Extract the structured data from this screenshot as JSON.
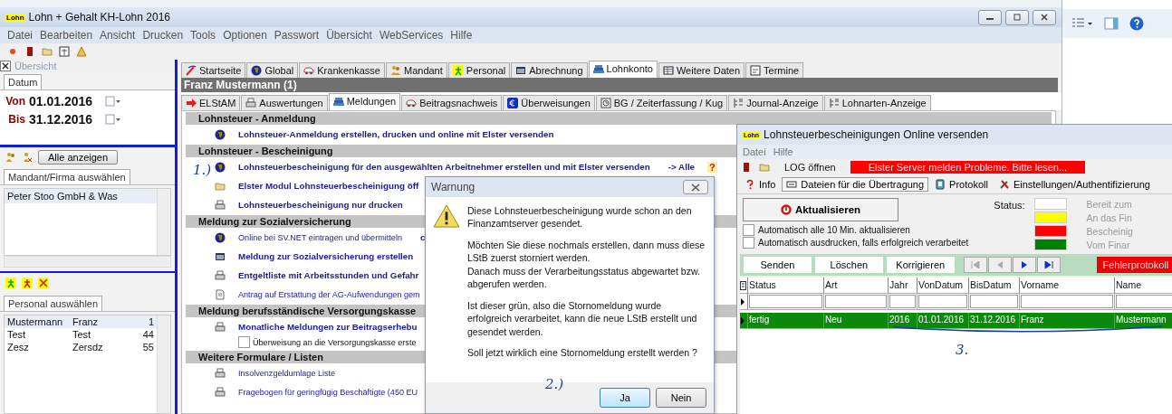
{
  "window": {
    "logo": "Lohn",
    "title": "Lohn + Gehalt KH-Lohn 2016"
  },
  "menu": [
    "Datei",
    "Bearbeiten",
    "Ansicht",
    "Drucken",
    "Tools",
    "Optionen",
    "Passwort",
    "Übersicht",
    "WebServices",
    "Hilfe"
  ],
  "overview": {
    "title": "Übersicht",
    "date_tab": "Datum",
    "from_label": "Von",
    "from": "01.01.2016",
    "to_label": "Bis",
    "to": "31.12.2016"
  },
  "clients": {
    "button": "Alle anzeigen",
    "tab": "Mandant/Firma auswählen",
    "rows": [
      {
        "name": "Peter Stoo GmbH & Was",
        "selected": true
      }
    ]
  },
  "staff": {
    "tab": "Personal auswählen",
    "rows": [
      {
        "last": "Mustermann",
        "first": "Franz",
        "number": "1",
        "selected": true
      },
      {
        "last": "Test",
        "first": "Test",
        "number": "44",
        "selected": false
      },
      {
        "last": "Zesz",
        "first": "Zersdz",
        "number": "55",
        "selected": false
      }
    ]
  },
  "tabs": [
    {
      "label": "Startseite",
      "selected": false
    },
    {
      "label": "Global",
      "selected": false
    },
    {
      "label": "Krankenkasse",
      "selected": false
    },
    {
      "label": "Mandant",
      "selected": false
    },
    {
      "label": "Personal",
      "selected": false
    },
    {
      "label": "Abrechnung",
      "selected": false
    },
    {
      "label": "Lohnkonto",
      "selected": true
    },
    {
      "label": "Weitere Daten",
      "selected": false
    },
    {
      "label": "Termine",
      "selected": false
    }
  ],
  "employee": "Franz Mustermann (1)",
  "subtabs": [
    {
      "label": "ELStAM",
      "selected": false
    },
    {
      "label": "Auswertungen",
      "selected": false
    },
    {
      "label": "Meldungen",
      "selected": true
    },
    {
      "label": "Beitragsnachweis",
      "selected": false
    },
    {
      "label": "Überweisungen",
      "selected": false
    },
    {
      "label": "BG / Zeiterfassung / Kug",
      "selected": false
    },
    {
      "label": "Journal-Anzeige",
      "selected": false
    },
    {
      "label": "Lohnarten-Anzeige",
      "selected": false
    }
  ],
  "sections": [
    {
      "title": "Lohnsteuer - Anmeldung",
      "items": [
        {
          "kind": "globe",
          "bold": true,
          "label": "Lohnsteuer-Anmeldung erstellen, drucken und online mit Elster versenden"
        }
      ]
    },
    {
      "title": "Lohnsteuer - Bescheinigung",
      "items": [
        {
          "kind": "globe",
          "bold": true,
          "label": "Lohnsteuerbescheinigung für den ausgewählten Arbeitnehmer erstellen und mit Elster versenden",
          "extra": "-> Alle",
          "help": "?"
        },
        {
          "kind": "folder",
          "bold": true,
          "label": "Elster Modul Lohnsteuerbescheinigung öff"
        },
        {
          "kind": "printer",
          "bold": true,
          "label": "Lohnsteuerbescheinigung nur drucken"
        }
      ]
    },
    {
      "title": "Meldung zur Sozialversicherung",
      "items": [
        {
          "kind": "globe",
          "bold": false,
          "label": "Online bei SV.NET eintragen und übermitteln",
          "extra": "c"
        },
        {
          "kind": "calculator",
          "bold": true,
          "label": "Meldung zur Sozialversicherung erstellen"
        },
        {
          "kind": "printer",
          "bold": true,
          "label": "Entgeltliste mit Arbeitsstunden und Gefahr"
        },
        {
          "kind": "document",
          "bold": false,
          "label": "Antrag auf Erstattung der AG-Aufwendungen gem"
        }
      ]
    },
    {
      "title": "Meldung berufsständische Versorgungskasse",
      "items": [
        {
          "kind": "printer",
          "bold": true,
          "label": "Monatliche Meldungen zur Beitragserhebu"
        },
        {
          "kind": "checkbox",
          "checked": false,
          "label": "Überweisung an die Versorgungskasse erste"
        }
      ]
    },
    {
      "title": "Weitere Formulare / Listen",
      "items": [
        {
          "kind": "printer",
          "bold": false,
          "label": "Insolvenzgeldumlage Liste"
        },
        {
          "kind": "printer",
          "bold": false,
          "label": "Fragebogen für geringfügig Beschäftigte (450 EU"
        }
      ]
    }
  ],
  "warning_dialog": {
    "title": "Warnung",
    "paragraphs": [
      "Diese Lohnsteuerbescheinigung wurde schon an den Finanzamtserver gesendet.",
      "Möchten Sie diese nochmals erstellen, dann muss diese LStB zuerst storniert werden.\nDanach muss der Verarbeitungsstatus abgewartet bzw. abgerufen werden.",
      "Ist dieser grün, also die Stornomeldung wurde erfolgreich verarbeitet, kann die neue LStB erstellt und gesendet werden.",
      "Soll jetzt wirklich eine Stornomeldung erstellt werden ?"
    ],
    "buttons": [
      {
        "label": "Ja",
        "selected": true
      },
      {
        "label": "Nein",
        "selected": false
      }
    ]
  },
  "elster_window": {
    "logo": "Lohn",
    "title": "Lohnsteuerbescheinigungen Online versenden",
    "menu": [
      "Datei",
      "Hilfe"
    ],
    "log_button": "LOG öffnen",
    "alert": "Elster Server melden Probleme. Bitte lesen...",
    "tabs": [
      {
        "label": "Info",
        "selected": false
      },
      {
        "label": "Dateien für die Übertragung",
        "selected": true
      },
      {
        "label": "Protokoll",
        "selected": false
      },
      {
        "label": "Einstellungen/Authentifizierung",
        "selected": false
      }
    ],
    "refresh": "Aktualisieren",
    "status_label": "Status:",
    "legend": [
      {
        "color": "#ffffff",
        "label": "Bereit zum"
      },
      {
        "color": "#ffff00",
        "label": "An das Fin"
      },
      {
        "color": "#ff0000",
        "label": "Bescheinig"
      },
      {
        "color": "#008000",
        "label": "Vom Finar"
      }
    ],
    "options": [
      {
        "label": "Automatisch alle 10 Min. aktualisieren",
        "checked": false
      },
      {
        "label": "Automatisch ausdrucken, falls erfolgreich verarbeitet",
        "checked": false
      }
    ],
    "actions": [
      "Senden",
      "Löschen",
      "Korrigieren"
    ],
    "nav": [
      {
        "kind": "first",
        "disabled": true
      },
      {
        "kind": "prev",
        "disabled": true
      },
      {
        "kind": "next",
        "disabled": false
      },
      {
        "kind": "last",
        "disabled": false
      }
    ],
    "error_button": "Fehlerprotokoll",
    "columns": [
      "Status",
      "Art",
      "Jahr",
      "VonDatum",
      "BisDatum",
      "Vorname",
      "Name"
    ],
    "rows": [
      {
        "cells": [
          "fertig",
          "Neu",
          "2016",
          "01.01.2016",
          "31.12.2016",
          "Franz",
          "Mustermann"
        ],
        "selected": true
      }
    ]
  },
  "annotations": [
    {
      "kind": "step",
      "label": "1.)"
    },
    {
      "kind": "step",
      "label": "2.)"
    },
    {
      "kind": "step",
      "label": "3."
    }
  ]
}
